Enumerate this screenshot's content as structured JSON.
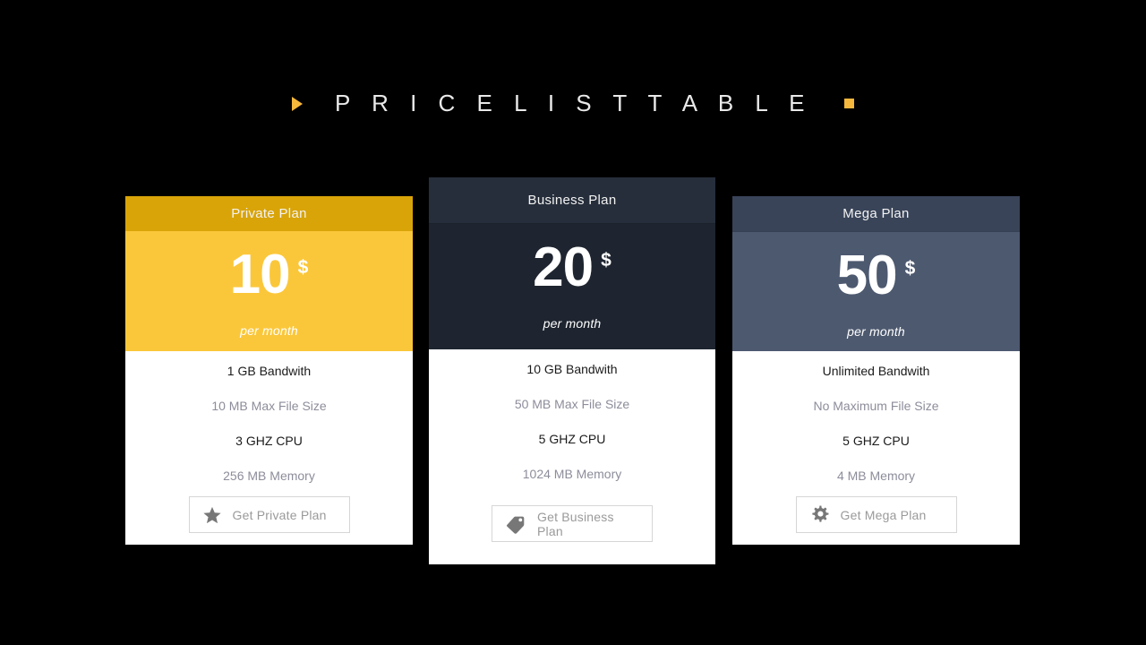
{
  "page": {
    "background_color": "#000000",
    "title": "P R I C E L I S T   T A B L E",
    "title_plain": "PRICELIST TABLE",
    "marker_color": "#F5B83D",
    "left_marker_icon": "triangle-right-icon",
    "right_marker_icon": "square-icon"
  },
  "plans": [
    {
      "id": "private",
      "name": "Private Plan",
      "price": "10",
      "currency": "$",
      "period": "per month",
      "header_color": "#D9A408",
      "price_color": "#FBC73A",
      "features": [
        {
          "text": "1 GB Bandwith",
          "style": "dark"
        },
        {
          "text": "10 MB Max File Size",
          "style": "light"
        },
        {
          "text": "3 GHZ CPU",
          "style": "dark"
        },
        {
          "text": "256 MB Memory",
          "style": "light"
        }
      ],
      "cta": {
        "label": "Get Private Plan",
        "icon": "star-icon"
      }
    },
    {
      "id": "business",
      "name": "Business Plan",
      "price": "20",
      "currency": "$",
      "period": "per month",
      "header_color": "#262E3B",
      "price_color": "#1E2530",
      "features": [
        {
          "text": "10 GB Bandwith",
          "style": "dark"
        },
        {
          "text": "50 MB Max File Size",
          "style": "light"
        },
        {
          "text": "5 GHZ CPU",
          "style": "dark"
        },
        {
          "text": "1024 MB Memory",
          "style": "light"
        }
      ],
      "cta": {
        "label": "Get Business Plan",
        "icon": "price-tag-icon"
      }
    },
    {
      "id": "mega",
      "name": "Mega Plan",
      "price": "50",
      "currency": "$",
      "period": "per month",
      "header_color": "#394459",
      "price_color": "#4D596F",
      "features": [
        {
          "text": "Unlimited Bandwith",
          "style": "dark"
        },
        {
          "text": "No Maximum File Size",
          "style": "light"
        },
        {
          "text": "5 GHZ CPU",
          "style": "dark"
        },
        {
          "text": "4 MB Memory",
          "style": "light"
        }
      ],
      "cta": {
        "label": "Get Mega Plan",
        "icon": "gear-icon"
      }
    }
  ]
}
